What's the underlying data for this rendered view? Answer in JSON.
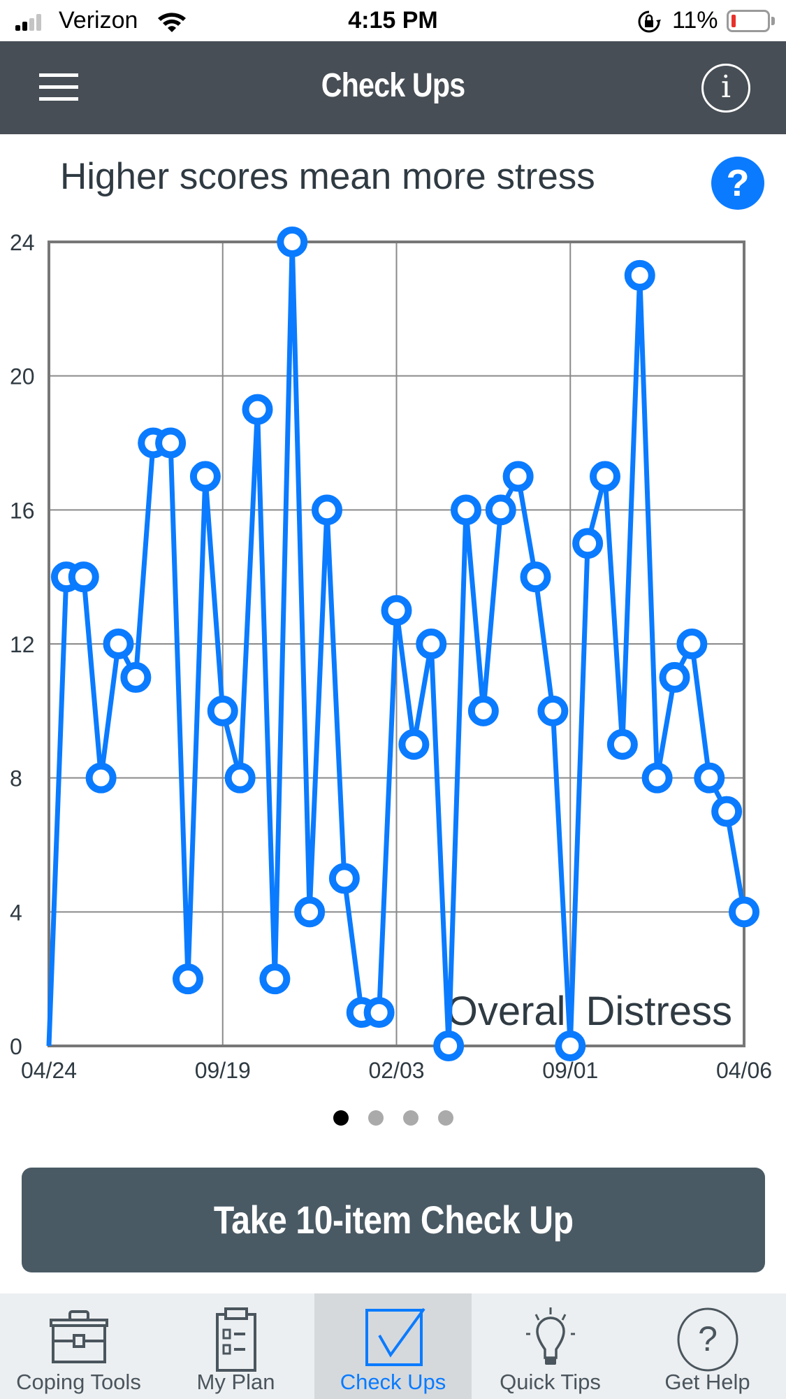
{
  "status_bar": {
    "carrier": "Verizon",
    "time": "4:15 PM",
    "battery_percent": "11%",
    "battery_level": 0.11,
    "icons": [
      "signal-icon",
      "wifi-icon",
      "orientation-lock-icon",
      "battery-icon"
    ]
  },
  "header": {
    "title": "Check Ups",
    "menu_icon": "hamburger-menu-icon",
    "info_icon": "info-icon",
    "info_glyph": "i"
  },
  "subtitle": {
    "text": "Higher scores mean more stress",
    "help_glyph": "?"
  },
  "chart_data": {
    "type": "line",
    "title": "Overall Distress",
    "xlabel": "",
    "ylabel": "",
    "ylim": [
      0,
      24
    ],
    "yticks": [
      0,
      4,
      8,
      12,
      16,
      20,
      24
    ],
    "ytick_labels": [
      "0",
      "4",
      "8",
      "12",
      "16",
      "20",
      "24"
    ],
    "xtick_labels": [
      "04/24",
      "09/19",
      "02/03",
      "09/01",
      "04/06"
    ],
    "grid": true,
    "legend": "bottom-right label",
    "series": [
      {
        "name": "Overall Distress",
        "color": "#0a7bff",
        "values": [
          0,
          14,
          14,
          8,
          12,
          11,
          18,
          18,
          2,
          17,
          10,
          8,
          19,
          2,
          24,
          4,
          16,
          5,
          1,
          1,
          13,
          9,
          12,
          0,
          16,
          10,
          16,
          17,
          14,
          10,
          0,
          15,
          17,
          9,
          23,
          8,
          11,
          12,
          8,
          7,
          4
        ],
        "first_point_marker": false
      }
    ]
  },
  "pager": {
    "count": 4,
    "active_index": 0
  },
  "cta": {
    "label": "Take 10-item Check Up"
  },
  "tab_bar": {
    "items": [
      {
        "label": "Coping Tools",
        "icon": "toolbox-icon",
        "active": false
      },
      {
        "label": "My Plan",
        "icon": "clipboard-checklist-icon",
        "active": false
      },
      {
        "label": "Check Ups",
        "icon": "checkbox-icon",
        "active": true
      },
      {
        "label": "Quick Tips",
        "icon": "lightbulb-icon",
        "active": false
      },
      {
        "label": "Get Help",
        "icon": "question-circle-icon",
        "active": false
      }
    ]
  },
  "colors": {
    "header_bg": "#474e55",
    "accent": "#0a7bff",
    "button_bg": "#4a5a64",
    "tab_bar_bg": "#eceff1",
    "tab_active_bg": "#d5d9dc",
    "battery_low": "#e8312b"
  }
}
